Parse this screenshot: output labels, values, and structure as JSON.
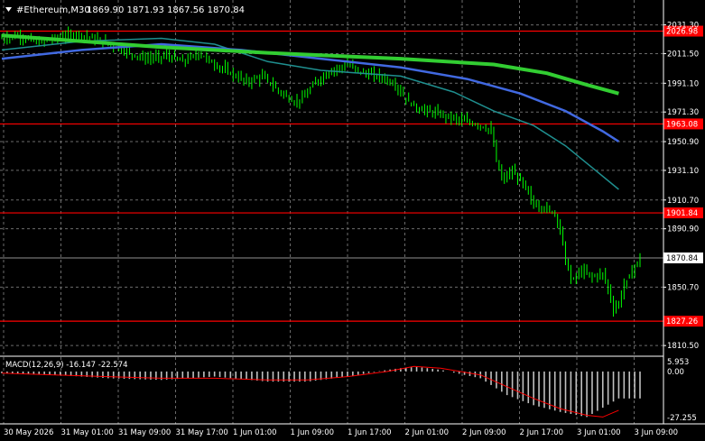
{
  "header": {
    "symbol_label": "#Ethereum,M30",
    "ohlc_label": "1869.90 1871.93 1867.56 1870.84"
  },
  "macd": {
    "label": "MACD(12,26,9) -16.147 -22.574",
    "axis_labels": [
      "5.953",
      "0.00",
      "-27.255"
    ]
  },
  "colors": {
    "background": "#000000",
    "grid": "#6b6b6b",
    "candles": "#00ff00",
    "levels": "#ff0000",
    "ma_fast": "#1f8f8f",
    "ma_mid": "#4169e1",
    "ma_slow": "#32cd32",
    "macd_hist": "#c0c0c0",
    "macd_signal": "#ff0000",
    "price_line": "#c0c0c0"
  },
  "chart_data": {
    "type": "candlestick",
    "symbol": "#Ethereum",
    "timeframe": "M30",
    "current_price": 1870.84,
    "ylim": [
      1805,
      2036
    ],
    "y_ticks": [
      2031.3,
      2011.5,
      1991.1,
      1971.3,
      1950.9,
      1931.1,
      1910.7,
      1890.9,
      1850.7,
      1810.5
    ],
    "x_ticks": [
      "30 May 2026",
      "31 May 01:00",
      "31 May 09:00",
      "31 May 17:00",
      "1 Jun 01:00",
      "1 Jun 09:00",
      "1 Jun 17:00",
      "2 Jun 01:00",
      "2 Jun 09:00",
      "2 Jun 17:00",
      "3 Jun 01:00",
      "3 Jun 09:00"
    ],
    "horizontal_levels": [
      {
        "value": 2026.98,
        "label": "2026.98"
      },
      {
        "value": 1963.08,
        "label": "1963.08"
      },
      {
        "value": 1901.84,
        "label": "1901.84"
      },
      {
        "value": 1827.26,
        "label": "1827.26"
      }
    ],
    "close_path": [
      [
        0,
        2022
      ],
      [
        6,
        2024
      ],
      [
        14,
        2019
      ],
      [
        22,
        2023
      ],
      [
        28,
        2025
      ],
      [
        34,
        2022
      ],
      [
        40,
        2018
      ],
      [
        48,
        2012
      ],
      [
        54,
        2008
      ],
      [
        62,
        2010
      ],
      [
        68,
        2006
      ],
      [
        74,
        2012
      ],
      [
        80,
        2004
      ],
      [
        86,
        1998
      ],
      [
        92,
        1992
      ],
      [
        98,
        1996
      ],
      [
        104,
        1986
      ],
      [
        110,
        1978
      ],
      [
        114,
        1982
      ],
      [
        118,
        1992
      ],
      [
        124,
        2000
      ],
      [
        130,
        2004
      ],
      [
        136,
        1998
      ],
      [
        142,
        1996
      ],
      [
        148,
        1990
      ],
      [
        152,
        1980
      ],
      [
        156,
        1974
      ],
      [
        160,
        1972
      ],
      [
        164,
        1970
      ],
      [
        168,
        1968
      ],
      [
        172,
        1966
      ],
      [
        176,
        1964
      ],
      [
        180,
        1962
      ],
      [
        184,
        1958
      ],
      [
        186,
        1938
      ],
      [
        188,
        1925
      ],
      [
        192,
        1930
      ],
      [
        196,
        1922
      ],
      [
        200,
        1908
      ],
      [
        204,
        1905
      ],
      [
        208,
        1902
      ],
      [
        210,
        1890
      ],
      [
        212,
        1870
      ],
      [
        214,
        1855
      ],
      [
        218,
        1862
      ],
      [
        222,
        1858
      ],
      [
        226,
        1860
      ],
      [
        228,
        1850
      ],
      [
        230,
        1835
      ],
      [
        232,
        1840
      ],
      [
        234,
        1852
      ],
      [
        237,
        1862
      ],
      [
        240,
        1871
      ]
    ],
    "ma_fast": [
      [
        0,
        2014
      ],
      [
        30,
        2020
      ],
      [
        60,
        2022
      ],
      [
        80,
        2018
      ],
      [
        100,
        2006
      ],
      [
        120,
        2000
      ],
      [
        150,
        1996
      ],
      [
        170,
        1985
      ],
      [
        185,
        1972
      ],
      [
        200,
        1962
      ],
      [
        212,
        1948
      ],
      [
        224,
        1930
      ],
      [
        232,
        1918
      ]
    ],
    "ma_mid": [
      [
        0,
        2008
      ],
      [
        30,
        2014
      ],
      [
        60,
        2018
      ],
      [
        90,
        2014
      ],
      [
        120,
        2008
      ],
      [
        150,
        2002
      ],
      [
        175,
        1994
      ],
      [
        195,
        1984
      ],
      [
        212,
        1972
      ],
      [
        226,
        1958
      ],
      [
        232,
        1951
      ]
    ],
    "ma_slow": [
      [
        0,
        2024
      ],
      [
        30,
        2020
      ],
      [
        60,
        2016
      ],
      [
        100,
        2012
      ],
      [
        150,
        2008
      ],
      [
        185,
        2004
      ],
      [
        205,
        1998
      ],
      [
        220,
        1990
      ],
      [
        232,
        1984
      ]
    ],
    "macd_panel": {
      "ylim": [
        -30,
        8
      ],
      "histogram": [
        [
          0,
          -1
        ],
        [
          20,
          -2
        ],
        [
          40,
          -4
        ],
        [
          60,
          -5
        ],
        [
          80,
          -3
        ],
        [
          100,
          -6
        ],
        [
          115,
          -6
        ],
        [
          130,
          -3
        ],
        [
          145,
          1
        ],
        [
          155,
          3
        ],
        [
          165,
          1
        ],
        [
          180,
          -4
        ],
        [
          190,
          -14
        ],
        [
          200,
          -20
        ],
        [
          210,
          -24
        ],
        [
          220,
          -27
        ],
        [
          232,
          -16
        ]
      ],
      "signal": [
        [
          0,
          -1
        ],
        [
          20,
          -2
        ],
        [
          40,
          -3
        ],
        [
          60,
          -4
        ],
        [
          80,
          -4
        ],
        [
          100,
          -5
        ],
        [
          115,
          -5
        ],
        [
          130,
          -3
        ],
        [
          145,
          0
        ],
        [
          155,
          3
        ],
        [
          165,
          2
        ],
        [
          180,
          -2
        ],
        [
          190,
          -9
        ],
        [
          200,
          -16
        ],
        [
          210,
          -22
        ],
        [
          220,
          -26
        ],
        [
          226,
          -27
        ],
        [
          232,
          -23
        ]
      ]
    }
  }
}
